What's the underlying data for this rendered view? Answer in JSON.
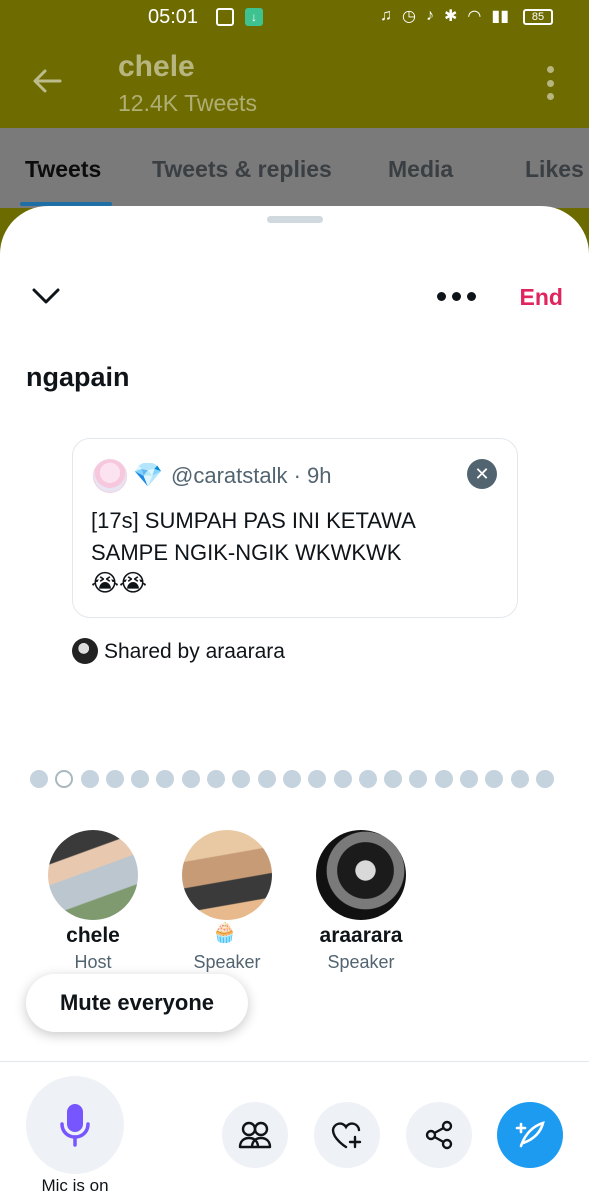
{
  "status_bar": {
    "time": "05:01",
    "battery": "85",
    "icons": [
      "headphones-icon",
      "alarm-icon",
      "mute-icon",
      "bluetooth-icon",
      "wifi-icon",
      "signal-icon"
    ]
  },
  "header": {
    "name": "chele",
    "tweet_count": "12.4K Tweets"
  },
  "tabs": [
    {
      "label": "Tweets",
      "active": true
    },
    {
      "label": "Tweets & replies",
      "active": false
    },
    {
      "label": "Media",
      "active": false
    },
    {
      "label": "Likes",
      "active": false
    }
  ],
  "space": {
    "end_label": "End",
    "title": "ngapain",
    "pinned_tweet": {
      "handle": "@caratstalk · 9h",
      "text": "[17s] SUMPAH PAS INI KETAWA SAMPE NGIK-NGIK WKWKWK",
      "emoji": "😭😭"
    },
    "shared_by": "Shared by araarara",
    "pager": {
      "total": 21,
      "active_index": 1
    },
    "speakers": [
      {
        "name": "chele",
        "role": "Host"
      },
      {
        "name": "",
        "role": "Speaker",
        "badge": "🧁"
      },
      {
        "name": "araarara",
        "role": "Speaker"
      }
    ],
    "mute_everyone_label": "Mute everyone",
    "mic_label": "Mic is on"
  },
  "colors": {
    "accent": "#1d9bf0",
    "end": "#e0245e",
    "mic": "#7856ff",
    "header_bg": "#6e6c00"
  }
}
